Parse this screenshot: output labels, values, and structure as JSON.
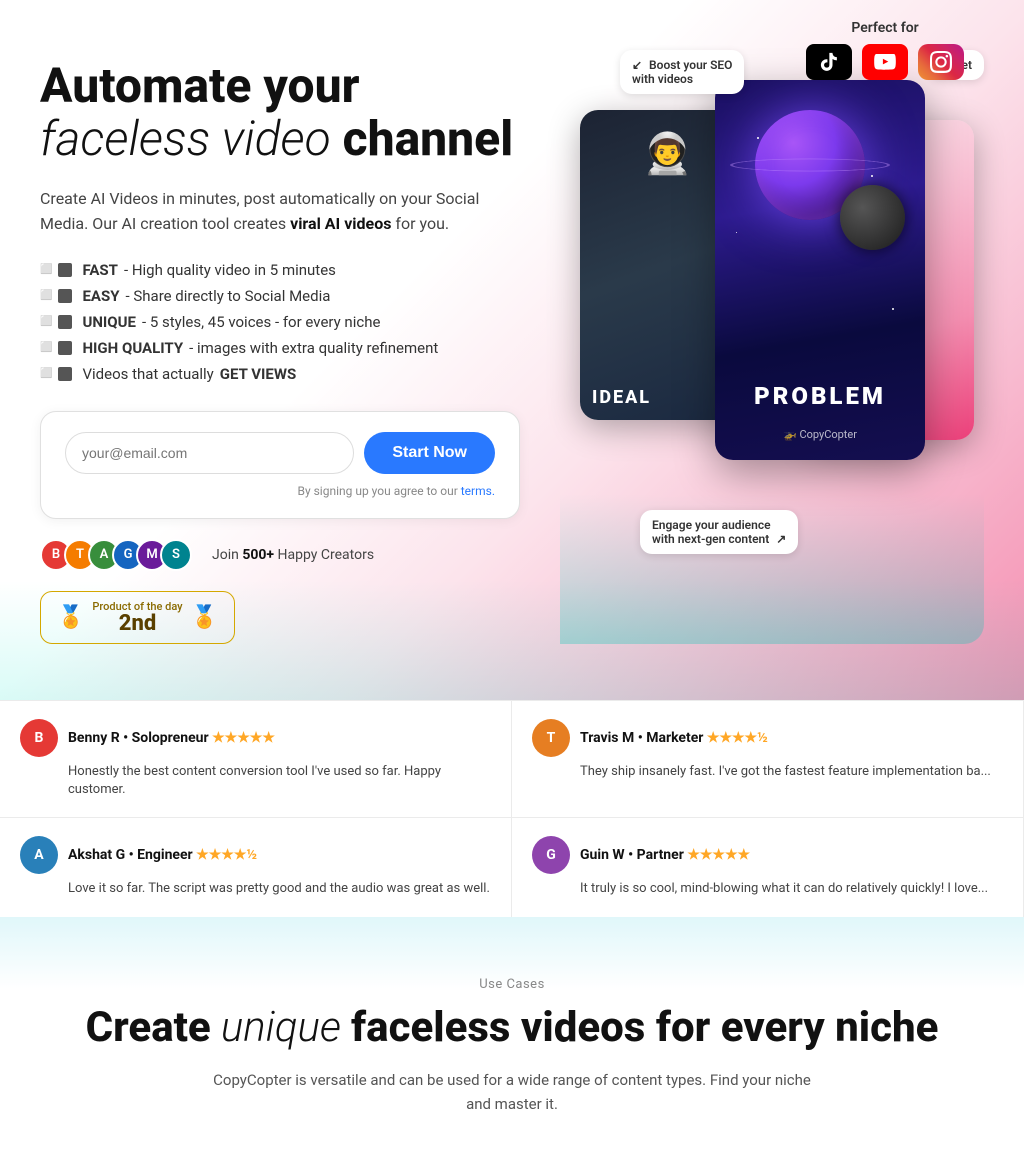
{
  "hero": {
    "perfect_for_label": "Perfect for",
    "headline_line1_bold": "Automate your",
    "headline_line2_italic": "faceless video",
    "headline_line2_bold": " channel",
    "subheadline": "Create AI Videos in minutes, post automatically on your Social Media. Our AI creation tool creates ",
    "subheadline_viral": "viral AI videos",
    "subheadline_end": " for you.",
    "features": [
      {
        "bold": "FAST",
        "text": " - High quality video in 5 minutes"
      },
      {
        "bold": "EASY",
        "text": " - Share directly to Social Media"
      },
      {
        "bold": "UNIQUE",
        "text": " - 5 styles, 45 voices - for every niche"
      },
      {
        "bold": "HIGH QUALITY",
        "text": " - images with extra quality refinement"
      },
      {
        "bold": "",
        "text": "Videos that actually ",
        "bold2": "GET VIEWS"
      }
    ],
    "email_placeholder": "your@email.com",
    "start_now_label": "Start Now",
    "terms_prefix": "By signing up you agree to our ",
    "terms_link": "terms.",
    "creators_count": "500+",
    "creators_label": "Happy Creators",
    "creators_prefix": "Join ",
    "product_of_day_label": "Product of the day",
    "product_of_day_rank": "2nd",
    "annotation_boost": "Boost your SEO\nwith videos",
    "annotation_get": "Get",
    "annotation_engage": "Engage your audience\nwith next-gen content",
    "card_main_label": "PROBLEM",
    "card_main_logo": "🚁 CopyCopter",
    "card_left_label": "IDEAL",
    "video_card_bg_desc": "space planet purple"
  },
  "reviews": [
    {
      "name": "Benny R • Solopreneur",
      "stars": "★★★★★",
      "half": false,
      "text": "Honestly the best content conversion tool I've used so far. Happy customer.",
      "color": "#e53935",
      "initials": "B"
    },
    {
      "name": "Travis M • Marketer",
      "stars": "★★★★",
      "half": true,
      "text": "They ship insanely fast. I've got the fastest feature implementation ba...",
      "color": "#e67e22",
      "initials": "T"
    },
    {
      "name": "Akshat G • Engineer",
      "stars": "★★★★",
      "half": true,
      "text": "Love it so far. The script was pretty good and the audio was great as well.",
      "color": "#2980b9",
      "initials": "A"
    },
    {
      "name": "Guin W • Partner",
      "stars": "★★★★★",
      "half": false,
      "text": "It truly is so cool, mind-blowing what it can do relatively quickly! I love...",
      "color": "#8e44ad",
      "initials": "G"
    }
  ],
  "use_cases": {
    "label": "Use Cases",
    "headline_bold1": "Create",
    "headline_italic": " unique ",
    "headline_bold2": "faceless videos for every niche",
    "subtext": "CopyCopter is versatile and can be used for a wide range of content types. Find your niche and master it."
  },
  "social_icons": [
    {
      "name": "TikTok",
      "color": "#000"
    },
    {
      "name": "YouTube",
      "color": "#FF0000"
    },
    {
      "name": "Instagram",
      "color": "gradient"
    }
  ],
  "avatar_colors": [
    "#e53935",
    "#f57c00",
    "#388e3c",
    "#1565c0",
    "#6a1b9a",
    "#00838f"
  ]
}
